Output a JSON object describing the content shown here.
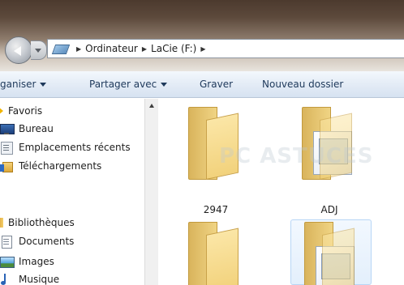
{
  "address": {
    "crumbs": [
      "Ordinateur",
      "LaCie (F:)"
    ],
    "icon": "computer-path-icon"
  },
  "toolbar": {
    "organize_label": "ganiser",
    "share_label": "Partager avec",
    "burn_label": "Graver",
    "new_folder_label": "Nouveau dossier"
  },
  "sidebar": {
    "favorites_header": "Favoris",
    "favorites": [
      {
        "label": "Bureau",
        "icon": "desktop-icon"
      },
      {
        "label": "Emplacements récents",
        "icon": "recent-places-icon"
      },
      {
        "label": "Téléchargements",
        "icon": "downloads-icon"
      }
    ],
    "libraries_header": "Bibliothèques",
    "libraries": [
      {
        "label": "Documents",
        "icon": "documents-icon"
      },
      {
        "label": "Images",
        "icon": "pictures-icon"
      },
      {
        "label": "Musique",
        "icon": "music-icon"
      }
    ]
  },
  "files": [
    {
      "name": "2947",
      "icon": "folder-icon"
    },
    {
      "name": "ADJ",
      "icon": "folder-icon"
    },
    {
      "name": "",
      "icon": "folder-icon"
    },
    {
      "name": "",
      "icon": "folder-icon"
    }
  ],
  "watermark": "PC ASTUCES"
}
